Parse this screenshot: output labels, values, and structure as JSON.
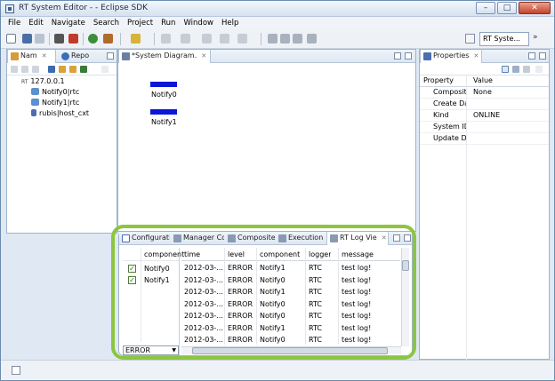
{
  "window": {
    "title": "RT System Editor - - Eclipse SDK"
  },
  "menu": [
    "File",
    "Edit",
    "Navigate",
    "Search",
    "Project",
    "Run",
    "Window",
    "Help"
  ],
  "toolbar": {
    "perspective_label": "RT Syste...",
    "overflow": "»"
  },
  "navigator": {
    "tabs": [
      "Nam",
      "Repo"
    ],
    "tree": {
      "root": "127.0.0.1",
      "root_prefix": "RT",
      "items": [
        "Notify0|rtc",
        "Notify1|rtc",
        "rubis|host_cxt"
      ]
    }
  },
  "editor": {
    "tab": "*System Diagram.",
    "components": [
      "Notify0",
      "Notify1"
    ],
    "component_color": "#0a17d9"
  },
  "properties": {
    "tab": "Properties",
    "headers": [
      "Property",
      "Value"
    ],
    "rows": [
      {
        "property": "Composite",
        "value": "None"
      },
      {
        "property": "Create Date",
        "value": ""
      },
      {
        "property": "Kind",
        "value": "ONLINE"
      },
      {
        "property": "System ID",
        "value": ""
      },
      {
        "property": "Update Date",
        "value": ""
      }
    ]
  },
  "bottom": {
    "tabs": [
      "Configurati",
      "Manager Co",
      "Composite",
      "Execution",
      "RT Log Vie"
    ],
    "tab_prefix": "RT",
    "filter": {
      "header": "component",
      "items": [
        {
          "name": "Notify0",
          "checked": true
        },
        {
          "name": "Notify1",
          "checked": true
        }
      ],
      "level_select": "ERROR"
    },
    "log": {
      "columns": [
        "time",
        "level",
        "component",
        "logger",
        "message"
      ],
      "rows": [
        [
          "2012-03-...",
          "ERROR",
          "Notify1",
          "RTC",
          "test log!"
        ],
        [
          "2012-03-...",
          "ERROR",
          "Notify0",
          "RTC",
          "test log!"
        ],
        [
          "2012-03-...",
          "ERROR",
          "Notify1",
          "RTC",
          "test log!"
        ],
        [
          "2012-03-...",
          "ERROR",
          "Notify0",
          "RTC",
          "test log!"
        ],
        [
          "2012-03-...",
          "ERROR",
          "Notify0",
          "RTC",
          "test log!"
        ],
        [
          "2012-03-...",
          "ERROR",
          "Notify1",
          "RTC",
          "test log!"
        ],
        [
          "2012-03-...",
          "ERROR",
          "Notify0",
          "RTC",
          "test log!"
        ]
      ]
    },
    "highlight_color": "#8cc63f"
  }
}
